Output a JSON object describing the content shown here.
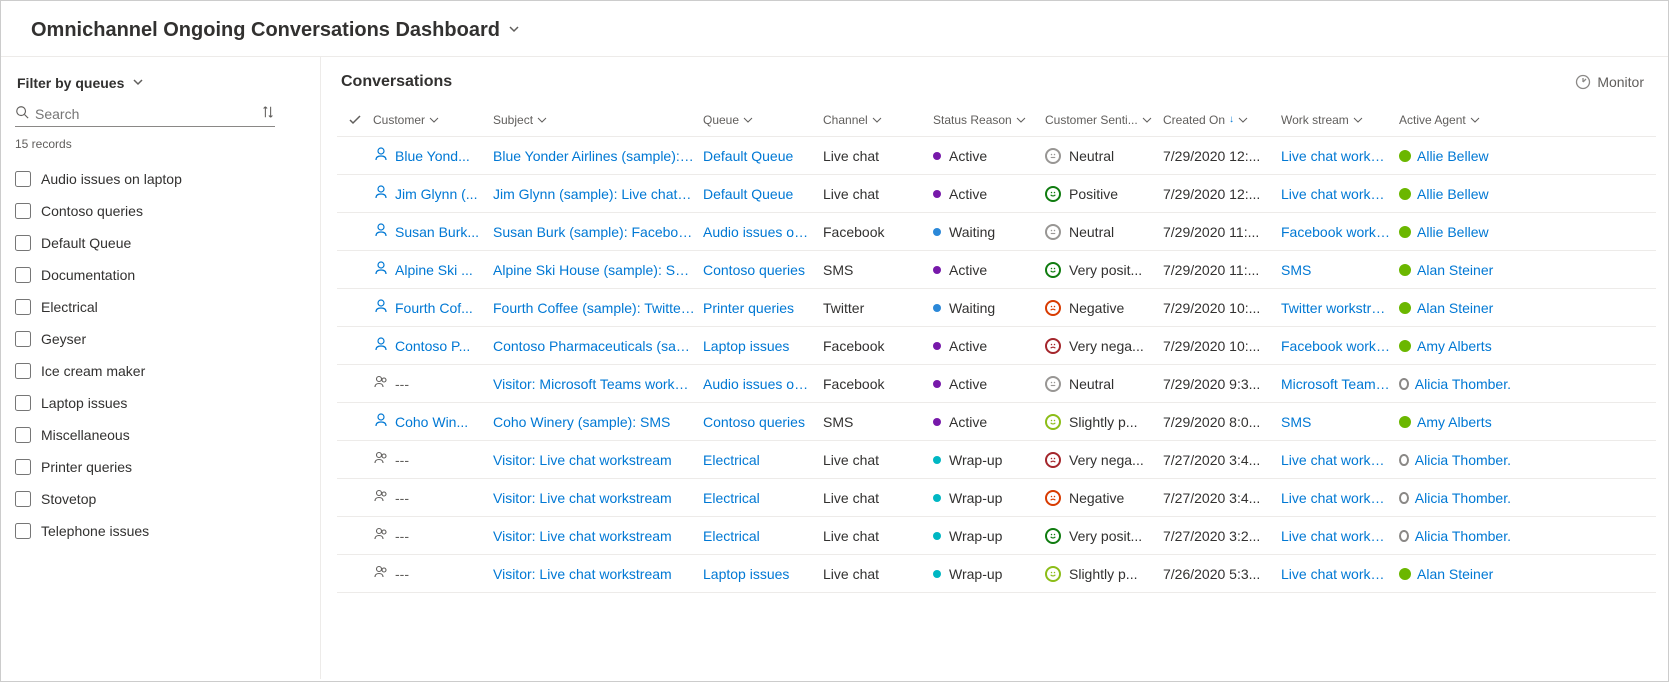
{
  "header": {
    "title": "Omnichannel Ongoing Conversations Dashboard"
  },
  "sidebar": {
    "title": "Filter by queues",
    "search_placeholder": "Search",
    "records_text": "15 records",
    "queues": [
      "Audio issues on laptop",
      "Contoso queries",
      "Default Queue",
      "Documentation",
      "Electrical",
      "Geyser",
      "Ice cream maker",
      "Laptop issues",
      "Miscellaneous",
      "Printer queries",
      "Stovetop",
      "Telephone issues"
    ]
  },
  "content": {
    "title": "Conversations",
    "monitor": "Monitor",
    "columns": {
      "customer": "Customer",
      "subject": "Subject",
      "queue": "Queue",
      "channel": "Channel",
      "status": "Status Reason",
      "sentiment": "Customer Senti...",
      "created": "Created On",
      "workstream": "Work stream",
      "agent": "Active Agent"
    },
    "rows": [
      {
        "customer": "Blue Yond...",
        "subject": "Blue Yonder Airlines (sample): Live c",
        "queue": "Default Queue",
        "channel": "Live chat",
        "status": "Active",
        "status_dot": "active",
        "sentiment": "Neutral",
        "sent_face": "neutral",
        "created": "7/29/2020 12:...",
        "workstream": "Live chat workstrea",
        "agent": "Allie Bellew",
        "presence": "avail",
        "cust_icon": "person"
      },
      {
        "customer": "Jim Glynn (...",
        "subject": "Jim Glynn (sample): Live chat works",
        "queue": "Default Queue",
        "channel": "Live chat",
        "status": "Active",
        "status_dot": "active",
        "sentiment": "Positive",
        "sent_face": "pos",
        "created": "7/29/2020 12:...",
        "workstream": "Live chat workstrea",
        "agent": "Allie Bellew",
        "presence": "avail",
        "cust_icon": "person"
      },
      {
        "customer": "Susan Burk...",
        "subject": "Susan Burk (sample): Facebook wor",
        "queue": "Audio issues on lap",
        "channel": "Facebook",
        "status": "Waiting",
        "status_dot": "waiting",
        "sentiment": "Neutral",
        "sent_face": "neutral",
        "created": "7/29/2020 11:...",
        "workstream": "Facebook workstre",
        "agent": "Allie Bellew",
        "presence": "avail",
        "cust_icon": "person"
      },
      {
        "customer": "Alpine Ski ...",
        "subject": "Alpine Ski House (sample): SMS",
        "queue": "Contoso queries",
        "channel": "SMS",
        "status": "Active",
        "status_dot": "active",
        "sentiment": "Very posit...",
        "sent_face": "vpos",
        "created": "7/29/2020 11:...",
        "workstream": "SMS",
        "agent": "Alan Steiner",
        "presence": "avail",
        "cust_icon": "person"
      },
      {
        "customer": "Fourth Cof...",
        "subject": "Fourth Coffee (sample): Twitter wor",
        "queue": "Printer queries",
        "channel": "Twitter",
        "status": "Waiting",
        "status_dot": "waiting",
        "sentiment": "Negative",
        "sent_face": "neg",
        "created": "7/29/2020 10:...",
        "workstream": "Twitter workstream",
        "agent": "Alan Steiner",
        "presence": "avail",
        "cust_icon": "person"
      },
      {
        "customer": "Contoso P...",
        "subject": "Contoso Pharmaceuticals (sample):",
        "queue": "Laptop issues",
        "channel": "Facebook",
        "status": "Active",
        "status_dot": "active",
        "sentiment": "Very nega...",
        "sent_face": "vneg",
        "created": "7/29/2020 10:...",
        "workstream": "Facebook workstre",
        "agent": "Amy Alberts",
        "presence": "avail",
        "cust_icon": "person"
      },
      {
        "customer": "---",
        "subject": "Visitor: Microsoft Teams workstrean",
        "queue": "Audio issues on lap",
        "channel": "Facebook",
        "status": "Active",
        "status_dot": "active",
        "sentiment": "Neutral",
        "sent_face": "neutral",
        "created": "7/29/2020 9:3...",
        "workstream": "Microsoft Teams w",
        "agent": "Alicia Thomber.",
        "presence": "off",
        "cust_icon": "people"
      },
      {
        "customer": "Coho Win...",
        "subject": "Coho Winery (sample): SMS",
        "queue": "Contoso queries",
        "channel": "SMS",
        "status": "Active",
        "status_dot": "active",
        "sentiment": "Slightly p...",
        "sent_face": "spos",
        "created": "7/29/2020 8:0...",
        "workstream": "SMS",
        "agent": "Amy Alberts",
        "presence": "avail",
        "cust_icon": "person"
      },
      {
        "customer": "---",
        "subject": "Visitor: Live chat workstream",
        "queue": "Electrical",
        "channel": "Live chat",
        "status": "Wrap-up",
        "status_dot": "wrap",
        "sentiment": "Very nega...",
        "sent_face": "vneg",
        "created": "7/27/2020 3:4...",
        "workstream": "Live chat workstrea",
        "agent": "Alicia Thomber.",
        "presence": "off",
        "cust_icon": "people"
      },
      {
        "customer": "---",
        "subject": "Visitor: Live chat workstream",
        "queue": "Electrical",
        "channel": "Live chat",
        "status": "Wrap-up",
        "status_dot": "wrap",
        "sentiment": "Negative",
        "sent_face": "neg",
        "created": "7/27/2020 3:4...",
        "workstream": "Live chat workstrea",
        "agent": "Alicia Thomber.",
        "presence": "off",
        "cust_icon": "people"
      },
      {
        "customer": "---",
        "subject": "Visitor: Live chat workstream",
        "queue": "Electrical",
        "channel": "Live chat",
        "status": "Wrap-up",
        "status_dot": "wrap",
        "sentiment": "Very posit...",
        "sent_face": "vpos",
        "created": "7/27/2020 3:2...",
        "workstream": "Live chat workstrea",
        "agent": "Alicia Thomber.",
        "presence": "off",
        "cust_icon": "people"
      },
      {
        "customer": "---",
        "subject": "Visitor: Live chat workstream",
        "queue": "Laptop issues",
        "channel": "Live chat",
        "status": "Wrap-up",
        "status_dot": "wrap",
        "sentiment": "Slightly p...",
        "sent_face": "spos",
        "created": "7/26/2020 5:3...",
        "workstream": "Live chat workstrea",
        "agent": "Alan Steiner",
        "presence": "avail",
        "cust_icon": "people"
      }
    ]
  }
}
